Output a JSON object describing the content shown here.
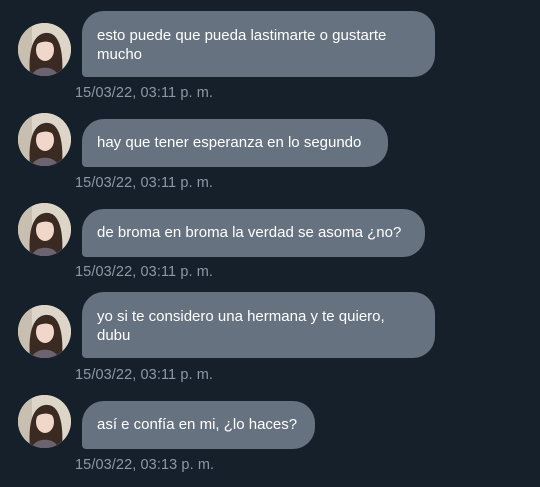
{
  "conversation": {
    "messages": [
      {
        "text": "esto puede que pueda lastimarte o gustarte mucho",
        "timestamp": "15/03/22, 03:11 p. m."
      },
      {
        "text": "hay que tener esperanza en lo segundo",
        "timestamp": "15/03/22, 03:11 p. m."
      },
      {
        "text": "de broma en broma la verdad se asoma ¿no?",
        "timestamp": "15/03/22, 03:11 p. m."
      },
      {
        "text": "yo si te considero una hermana y te quiero, dubu",
        "timestamp": "15/03/22, 03:11 p. m."
      },
      {
        "text": "así e confía en mi, ¿lo haces?",
        "timestamp": "15/03/22, 03:13 p. m."
      }
    ]
  },
  "theme": {
    "background": "#15202b",
    "bubble": "#66727f",
    "bubble_text": "#ffffff",
    "timestamp_text": "#8b98a5"
  },
  "icons": {
    "avatar": "user-photo-avatar"
  }
}
